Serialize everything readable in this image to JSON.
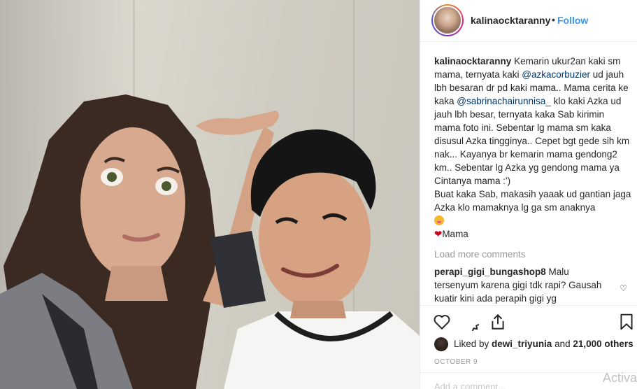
{
  "post": {
    "username": "kalinaocktaranny",
    "separator": "•",
    "follow_label": "Follow",
    "caption": {
      "username": "kalinaocktaranny",
      "text_1": "Kemarin ukur2an kaki sm mama, ternyata kaki ",
      "mention_1": "@azkacorbuzier",
      "text_2": " ud jauh lbh besaran dr pd kaki mama.. Mama cerita ke kaka ",
      "mention_2": "@sabrinachairunnisa_",
      "text_3": " klo kaki Azka ud jauh lbh besar, ternyata kaka Sab kirimin mama foto ini. Sebentar lg mama sm kaka disusul Azka tingginya.. Cepet bgt gede sih km nak... Kayanya br kemarin mama gendong2 km.. Sebentar lg Azka yg gendong mama ya Cintanya mama :')",
      "para_2": "Buat kaka Sab, makasih yaaak ud gantian jaga Azka klo mamaknya lg ga sm anaknya",
      "signoff": "Mama"
    },
    "load_more_label": "Load more comments",
    "comments": [
      {
        "username": "perapi_gigi_bungashop8",
        "text": "Malu tersenyum karena gigi tdk rapi? Gausah kuatir kini ada perapih gigi yg"
      }
    ],
    "icons": {
      "like": "heart-outline-icon",
      "comment": "comment-bubble-icon",
      "share": "share-icon",
      "save": "bookmark-icon",
      "comment_like": "small-heart-icon"
    },
    "likes": {
      "prefix": "Liked by ",
      "user": "dewi_triyunia",
      "middle": " and ",
      "count": "21,000 others"
    },
    "date": "OCTOBER 9",
    "add_comment_label": "Add a comment...",
    "overlay_text": "Activa"
  },
  "colors": {
    "link": "#3897f0",
    "mention": "#003569",
    "muted": "#999999",
    "text": "#262626",
    "heart": "#d0021b"
  }
}
